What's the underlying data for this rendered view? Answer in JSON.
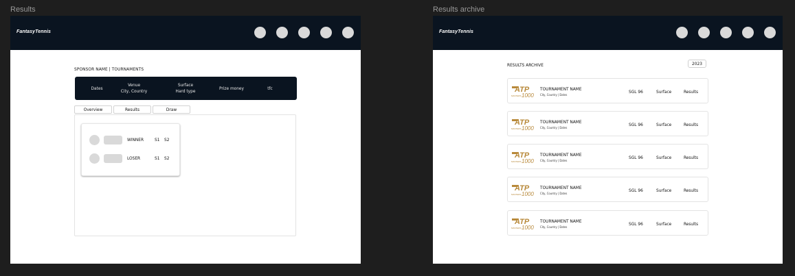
{
  "frames": {
    "results_label": "Results",
    "archive_label": "Results archive"
  },
  "header": {
    "brand": "FantasyTennis",
    "nav_count": 5
  },
  "results": {
    "breadcrumb": "SPONSOR NAME | TOURNAMENTS",
    "info": {
      "dates": "Dates",
      "venue_line1": "Venue",
      "venue_line2": "City, Country",
      "surface_line1": "Surface",
      "surface_line2": "Hard type",
      "prize": "Prize money",
      "tfc": "tfc"
    },
    "tabs": [
      "Overview",
      "Results",
      "Draw"
    ],
    "match": {
      "winner": {
        "name": "WINNER",
        "s1": "S1",
        "s2": "S2"
      },
      "loser": {
        "name": "LOSER",
        "s1": "S1",
        "s2": "S2"
      }
    }
  },
  "archive": {
    "title": "RESULTS ARCHIVE",
    "year": "2023",
    "logo": {
      "text": "ATP",
      "sub": "MASTERS",
      "num": "1000",
      "color": "#b8893a"
    },
    "tournaments": [
      {
        "name": "TOURNAMENT NAME",
        "sub": "City, Country | Dates",
        "draw": "SGL 96",
        "surface": "Surface",
        "results": "Results"
      },
      {
        "name": "TOURNAMENT NAME",
        "sub": "City, Country | Dates",
        "draw": "SGL 96",
        "surface": "Surface",
        "results": "Results"
      },
      {
        "name": "TOURNAMENT NAME",
        "sub": "City, Country | Dates",
        "draw": "SGL 96",
        "surface": "Surface",
        "results": "Results"
      },
      {
        "name": "TOURNAMENT NAME",
        "sub": "City, Country | Dates",
        "draw": "SGL 96",
        "surface": "Surface",
        "results": "Results"
      },
      {
        "name": "TOURNAMENT NAME",
        "sub": "City, Country | Dates",
        "draw": "SGL 96",
        "surface": "Surface",
        "results": "Results"
      }
    ]
  },
  "colors": {
    "header_bg": "#0a1420",
    "canvas_bg": "#1e1e1e",
    "placeholder": "#d9d9d9"
  }
}
